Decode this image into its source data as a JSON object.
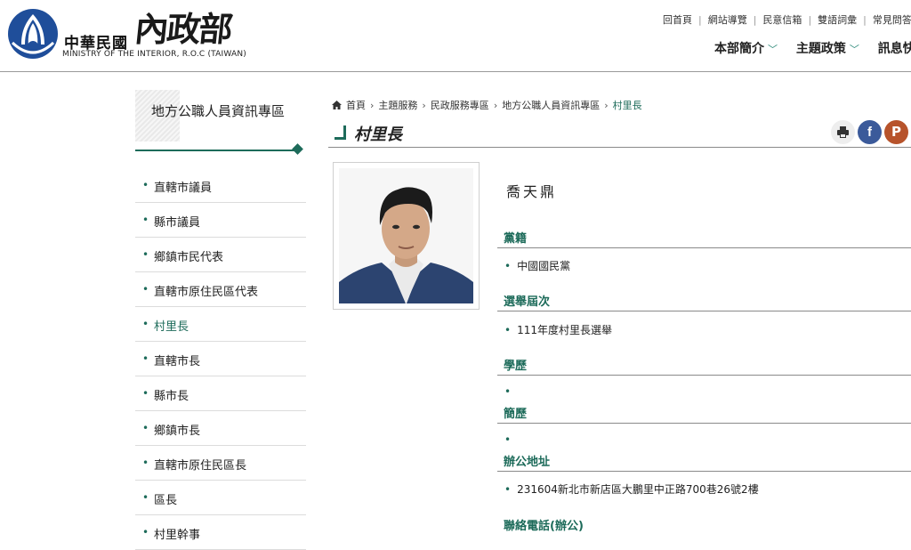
{
  "header": {
    "logo_cn": "中華民國",
    "logo_brush": "內政部",
    "logo_en": "MINISTRY OF THE INTERIOR, R.O.C (TAIWAN)",
    "util_links": [
      "回首頁",
      "網站導覽",
      "民意信箱",
      "雙語詞彙",
      "常見問答"
    ],
    "nav": [
      "本部簡介",
      "主題政策",
      "訊息快報"
    ]
  },
  "sidebar": {
    "title": "地方公職人員資訊專區",
    "items": [
      {
        "label": "直轄市議員",
        "active": false
      },
      {
        "label": "縣市議員",
        "active": false
      },
      {
        "label": "鄉鎮市民代表",
        "active": false
      },
      {
        "label": "直轄市原住民區代表",
        "active": false
      },
      {
        "label": "村里長",
        "active": true
      },
      {
        "label": "直轄市長",
        "active": false
      },
      {
        "label": "縣市長",
        "active": false
      },
      {
        "label": "鄉鎮市長",
        "active": false
      },
      {
        "label": "直轄市原住民區長",
        "active": false
      },
      {
        "label": "區長",
        "active": false
      },
      {
        "label": "村里幹事",
        "active": false
      }
    ]
  },
  "breadcrumb": [
    "首頁",
    "主題服務",
    "民政服務專區",
    "地方公職人員資訊專區",
    "村里長"
  ],
  "page_title": "村里長",
  "share": {
    "facebook": "f",
    "plurk": "P"
  },
  "person": {
    "name": "喬天鼎",
    "sections": [
      {
        "title": "黨籍",
        "value": "中國國民黨"
      },
      {
        "title": "選舉屆次",
        "value": "111年度村里長選舉"
      },
      {
        "title": "學歷",
        "value": ""
      },
      {
        "title": "簡歷",
        "value": ""
      },
      {
        "title": "辦公地址",
        "value": "231604新北市新店區大鵬里中正路700巷26號2樓"
      },
      {
        "title": "聯絡電話(辦公)",
        "value": ""
      }
    ]
  },
  "colors": {
    "accent": "#1d6b5a",
    "facebook": "#3b5a9a",
    "plurk": "#b7532b",
    "logo_blue": "#1f4e9a"
  }
}
